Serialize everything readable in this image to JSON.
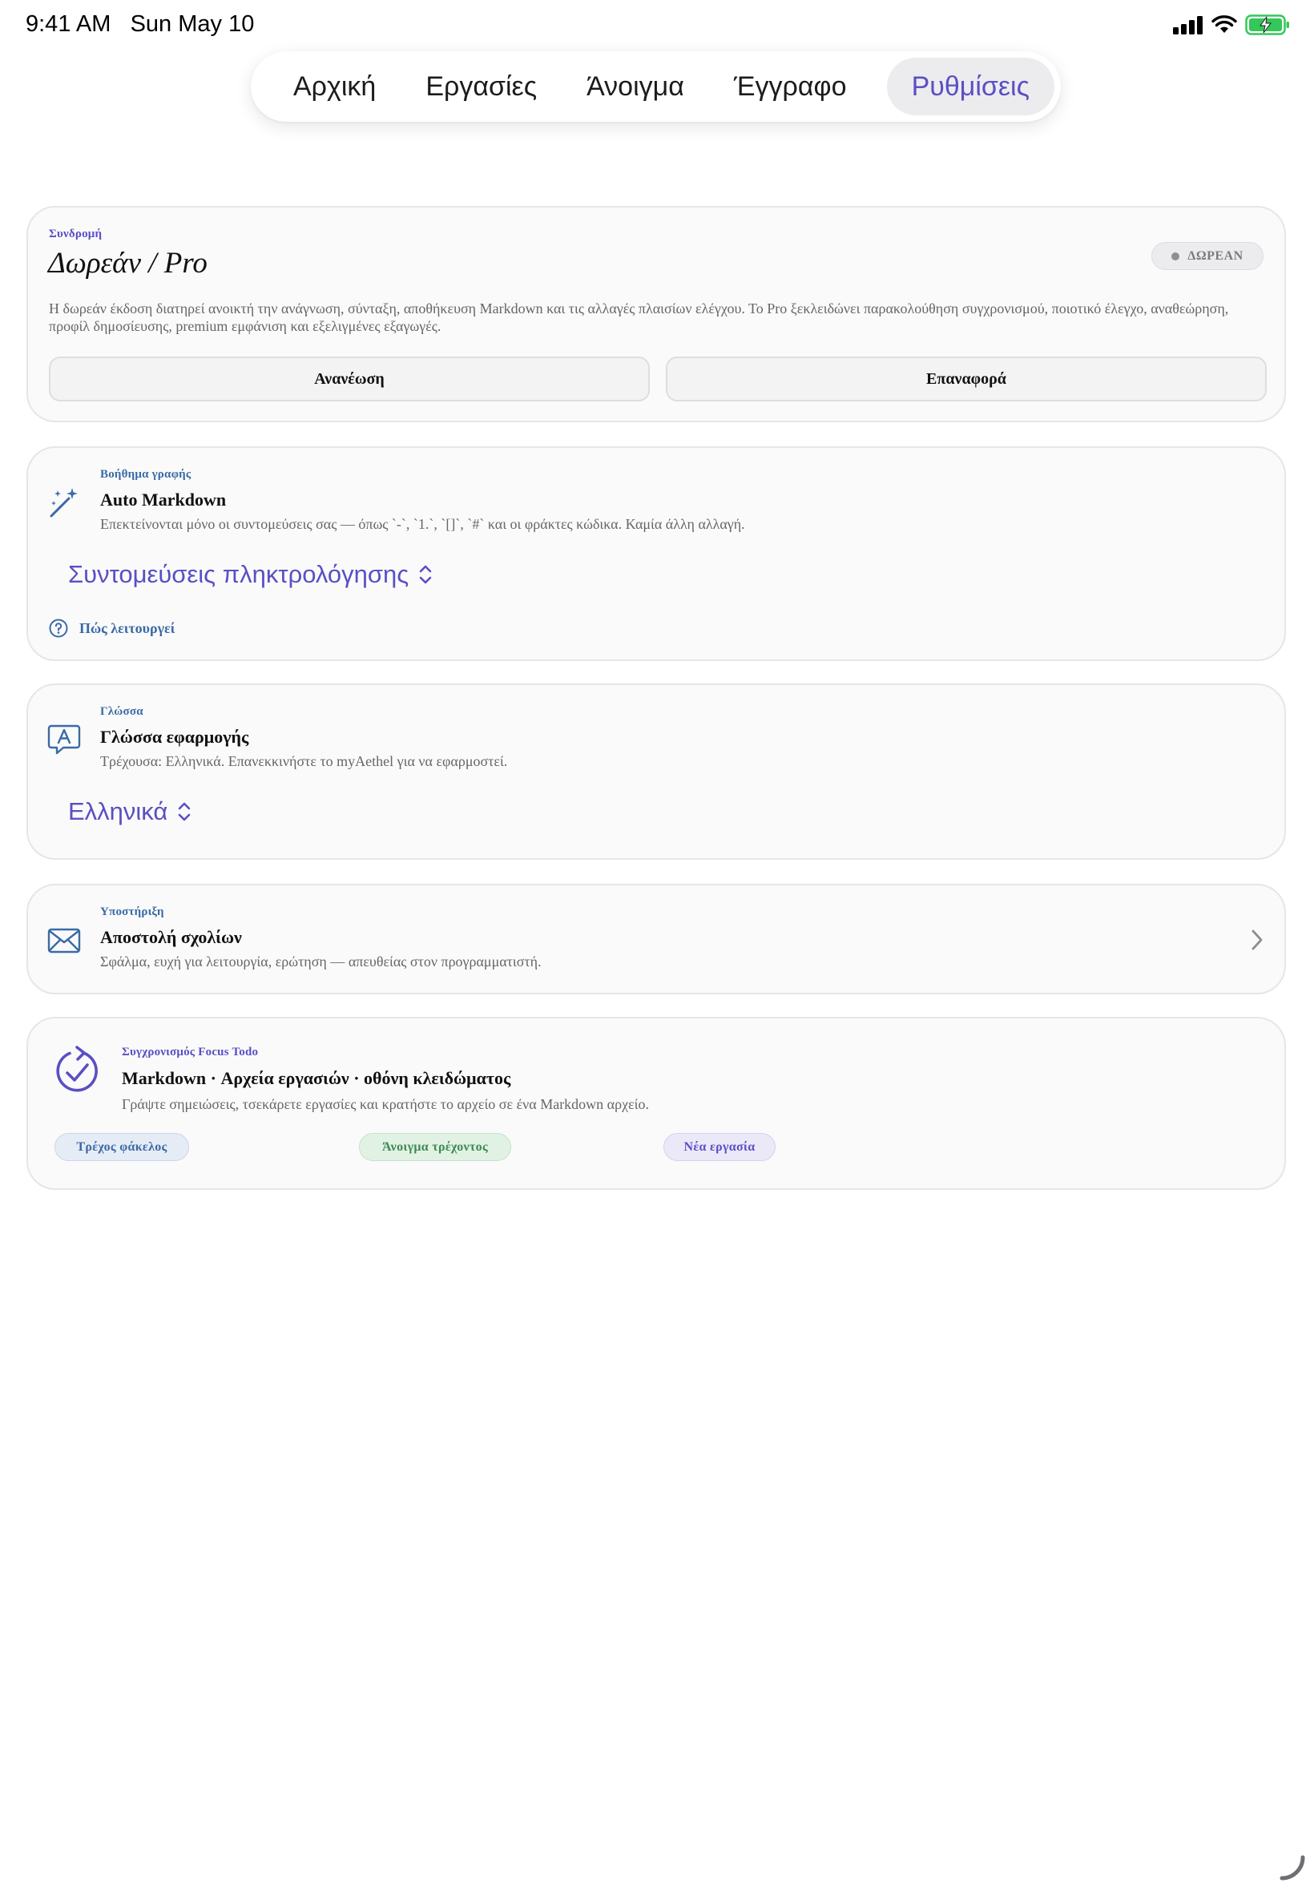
{
  "status_bar": {
    "time": "9:41 AM",
    "date": "Sun May 10"
  },
  "tabs": [
    {
      "label": "Αρχική"
    },
    {
      "label": "Εργασίες"
    },
    {
      "label": "Άνοιγμα"
    },
    {
      "label": "Έγγραφο"
    },
    {
      "label": "Ρυθμίσεις",
      "active": true
    }
  ],
  "subscription": {
    "eyebrow": "Συνδρομή",
    "title": "Δωρεάν / Pro",
    "badge": "ΔΩΡΕΑΝ",
    "description": "Η δωρεάν έκδοση διατηρεί ανοικτή την ανάγνωση, σύνταξη, αποθήκευση Markdown και τις αλλαγές πλαισίων ελέγχου. Το Pro ξεκλειδώνει παρακολούθηση συγχρονισμού, ποιοτικό έλεγχο, αναθεώρηση, προφίλ δημοσίευσης, premium εμφάνιση και εξελιγμένες εξαγωγές.",
    "refresh_label": "Ανανέωση",
    "restore_label": "Επαναφορά"
  },
  "writing_help": {
    "eyebrow": "Βοήθημα γραφής",
    "title": "Auto Markdown",
    "description": "Επεκτείνονται μόνο οι συντομεύσεις σας — όπως `-`, `1.`, `[]`, `#` και οι φράκτες κώδικα. Καμία άλλη αλλαγή.",
    "picker_value": "Συντομεύσεις πληκτρολόγησης",
    "how_label": "Πώς λειτουργεί",
    "icon": "magic-wand-icon"
  },
  "language": {
    "eyebrow": "Γλώσσα",
    "title": "Γλώσσα εφαρμογής",
    "description": "Τρέχουσα: Ελληνικά. Επανεκκινήστε το myAethel για να εφαρμοστεί.",
    "picker_value": "Ελληνικά",
    "icon": "translate-bubble-icon"
  },
  "support": {
    "eyebrow": "Υποστήριξη",
    "title": "Αποστολή σχολίων",
    "description": "Σφάλμα, ευχή για λειτουργία, ερώτηση — απευθείας στον προγραμματιστή.",
    "icon": "envelope-icon"
  },
  "sync": {
    "eyebrow": "Συγχρονισμός Focus Todo",
    "title": "Markdown · Αρχεία εργασιών · οθόνη κλειδώματος",
    "description": "Γράψτε σημειώσεις, τσεκάρετε εργασίες και κρατήστε το αρχείο σε ένα Markdown αρχείο.",
    "chips": [
      "Τρέχος φάκελος",
      "Άνοιγμα τρέχοντος",
      "Νέα εργασία"
    ],
    "icon": "sync-check-icon"
  },
  "colors": {
    "accent": "#5a4fc4",
    "link_blue": "#3a6aa6",
    "battery_green": "#34c759"
  }
}
